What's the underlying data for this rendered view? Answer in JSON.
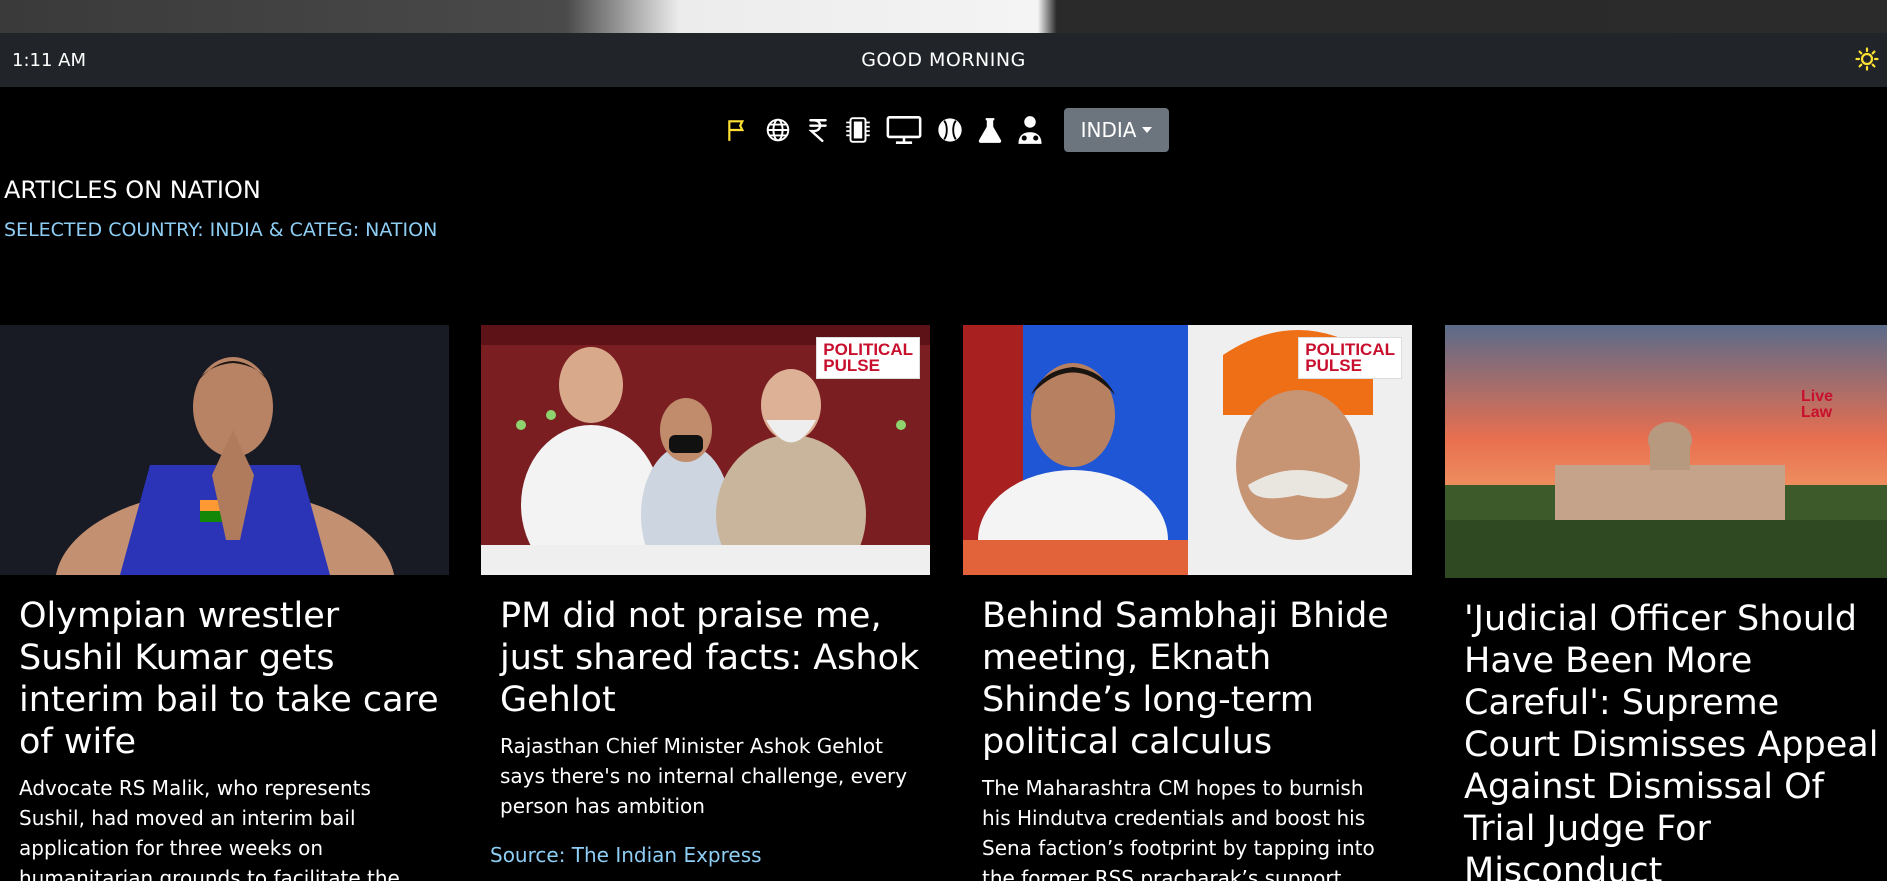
{
  "topbar": {
    "time": "1:11 AM",
    "greeting": "GOOD MORNING"
  },
  "categories": [
    {
      "icon": "flag-icon",
      "active": true
    },
    {
      "icon": "globe-icon",
      "active": false
    },
    {
      "icon": "rupee-icon",
      "active": false
    },
    {
      "icon": "chip-icon",
      "active": false
    },
    {
      "icon": "monitor-icon",
      "active": false
    },
    {
      "icon": "baseball-icon",
      "active": false
    },
    {
      "icon": "flask-icon",
      "active": false
    },
    {
      "icon": "doctor-icon",
      "active": false
    }
  ],
  "country_select": {
    "selected": "INDIA"
  },
  "main": {
    "heading": "ARTICLES ON NATION",
    "subheading": "SELECTED COUNTRY: INDIA & CATEG: NATION"
  },
  "articles": [
    {
      "title": "Olympian wrestler Sushil Kumar gets interim bail to take care of wife",
      "description": "Advocate RS Malik, who represents Sushil, had moved an interim bail application for three weeks on humanitarian grounds to facilitate the",
      "source": ""
    },
    {
      "title": "PM did not praise me, just shared facts: Ashok Gehlot",
      "description": "Rajasthan Chief Minister Ashok Gehlot says there's no internal challenge, every person has ambition",
      "source": "Source: The Indian Express",
      "badge": "POLITICAL PULSE"
    },
    {
      "title": "Behind Sambhaji Bhide meeting, Eknath Shinde’s long-term political calculus",
      "description": "The Maharashtra CM hopes to burnish his Hindutva credentials and boost his Sena faction’s footprint by tapping into the former RSS pracharak’s support",
      "source": "",
      "badge": "POLITICAL PULSE"
    },
    {
      "title": "'Judicial Officer Should Have Been More Careful': Supreme Court Dismisses Appeal Against Dismissal Of Trial Judge For Misconduct",
      "description": "",
      "source": "",
      "badge": "Live Law"
    }
  ],
  "colors": {
    "topbar_bg": "#212529",
    "accent_link": "#8ecdf4",
    "active_icon": "#ffe135",
    "button_bg": "#6c757d"
  }
}
